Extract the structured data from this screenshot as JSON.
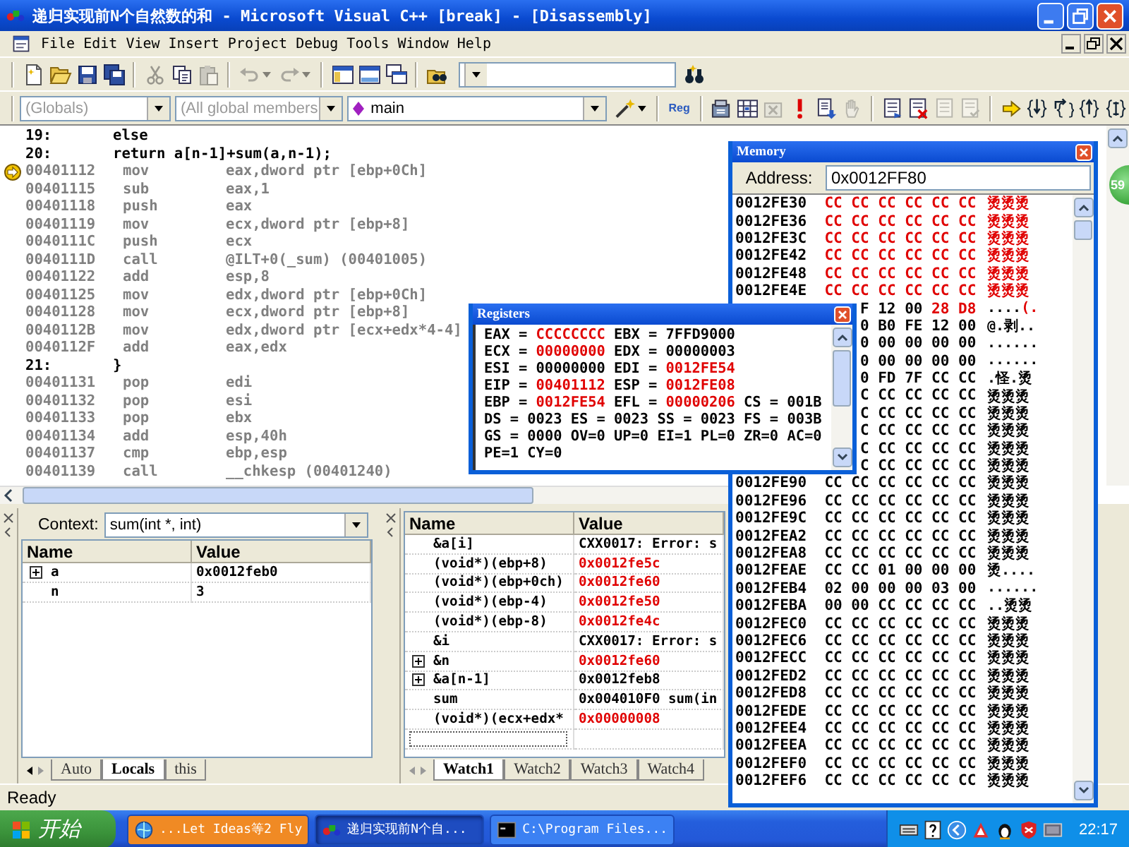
{
  "window": {
    "title": "递归实现前N个自然数的和 - Microsoft Visual C++ [break] - [Disassembly]"
  },
  "menu": [
    "File",
    "Edit",
    "View",
    "Insert",
    "Project",
    "Debug",
    "Tools",
    "Window",
    "Help"
  ],
  "toolbar_1": {
    "groups": [
      [
        {
          "kind": "new",
          "disabled": false
        },
        {
          "kind": "open",
          "disabled": false
        },
        {
          "kind": "save",
          "disabled": false
        },
        {
          "kind": "save_all",
          "disabled": false
        }
      ],
      [
        {
          "kind": "cut",
          "disabled": true
        },
        {
          "kind": "copy",
          "disabled": false
        },
        {
          "kind": "paste",
          "disabled": true
        }
      ],
      [
        {
          "kind": "undo",
          "disabled": true
        },
        {
          "kind": "redo",
          "disabled": true
        }
      ],
      [
        {
          "kind": "workspace",
          "disabled": false
        },
        {
          "kind": "output",
          "disabled": false
        },
        {
          "kind": "windows",
          "disabled": false
        }
      ],
      [
        {
          "kind": "find_in_files",
          "disabled": false
        }
      ]
    ],
    "after_field": [
      {
        "kind": "find",
        "disabled": false
      }
    ]
  },
  "toolbar_2": {
    "scope": {
      "value": "(Globals)",
      "disabled": true
    },
    "members": {
      "value": "(All global members",
      "disabled": true
    },
    "function": {
      "value": "main",
      "disabled": false
    },
    "groups": [
      [
        {
          "kind": "wizard",
          "disabled": false
        }
      ],
      [
        {
          "kind": "reg",
          "label": "Reg",
          "disabled": false
        }
      ],
      [
        {
          "kind": "compile",
          "disabled": false
        },
        {
          "kind": "build",
          "disabled": false
        },
        {
          "kind": "stop_build",
          "disabled": true
        },
        {
          "kind": "execute",
          "disabled": false
        },
        {
          "kind": "go",
          "disabled": false
        },
        {
          "kind": "breakpoint",
          "disabled": true
        }
      ],
      [
        {
          "kind": "list_arrow",
          "disabled": false
        },
        {
          "kind": "list_cross",
          "disabled": false
        },
        {
          "kind": "list_plain",
          "disabled": true
        },
        {
          "kind": "list_check",
          "disabled": true
        }
      ],
      [
        {
          "kind": "show_next",
          "disabled": false
        },
        {
          "kind": "step_into",
          "disabled": false
        },
        {
          "kind": "step_over",
          "disabled": false
        },
        {
          "kind": "step_out",
          "disabled": false
        },
        {
          "kind": "run_to_cursor",
          "disabled": false
        }
      ]
    ]
  },
  "disassembly": [
    {
      "kind": "source",
      "line": "19:",
      "code": "else"
    },
    {
      "kind": "source",
      "line": "20:",
      "code": "return a[n-1]+sum(a,n-1);"
    },
    {
      "kind": "asm",
      "address": "00401112",
      "op": "mov",
      "args": "eax,dword ptr [ebp+0Ch]",
      "current": true
    },
    {
      "kind": "asm",
      "address": "00401115",
      "op": "sub",
      "args": "eax,1",
      "current": false
    },
    {
      "kind": "asm",
      "address": "00401118",
      "op": "push",
      "args": "eax",
      "current": false
    },
    {
      "kind": "asm",
      "address": "00401119",
      "op": "mov",
      "args": "ecx,dword ptr [ebp+8]",
      "current": false
    },
    {
      "kind": "asm",
      "address": "0040111C",
      "op": "push",
      "args": "ecx",
      "current": false
    },
    {
      "kind": "asm",
      "address": "0040111D",
      "op": "call",
      "args": "@ILT+0(_sum) (00401005)",
      "current": false
    },
    {
      "kind": "asm",
      "address": "00401122",
      "op": "add",
      "args": "esp,8",
      "current": false
    },
    {
      "kind": "asm",
      "address": "00401125",
      "op": "mov",
      "args": "edx,dword ptr [ebp+0Ch]",
      "current": false
    },
    {
      "kind": "asm",
      "address": "00401128",
      "op": "mov",
      "args": "ecx,dword ptr [ebp+8]",
      "current": false
    },
    {
      "kind": "asm",
      "address": "0040112B",
      "op": "mov",
      "args": "edx,dword ptr [ecx+edx*4-4]",
      "current": false
    },
    {
      "kind": "asm",
      "address": "0040112F",
      "op": "add",
      "args": "eax,edx",
      "current": false
    },
    {
      "kind": "source",
      "line": "21:",
      "code": "}"
    },
    {
      "kind": "asm",
      "address": "00401131",
      "op": "pop",
      "args": "edi",
      "current": false
    },
    {
      "kind": "asm",
      "address": "00401132",
      "op": "pop",
      "args": "esi",
      "current": false
    },
    {
      "kind": "asm",
      "address": "00401133",
      "op": "pop",
      "args": "ebx",
      "current": false
    },
    {
      "kind": "asm",
      "address": "00401134",
      "op": "add",
      "args": "esp,40h",
      "current": false
    },
    {
      "kind": "asm",
      "address": "00401137",
      "op": "cmp",
      "args": "ebp,esp",
      "current": false
    },
    {
      "kind": "asm",
      "address": "00401139",
      "op": "call",
      "args": "__chkesp (00401240)",
      "current": false
    }
  ],
  "side_widget": {
    "text": "59"
  },
  "variables": {
    "context_label": "Context:",
    "context": "sum(int *, int)",
    "columns": [
      "Name",
      "Value"
    ],
    "rows": [
      {
        "name": "a",
        "value": "0x0012feb0",
        "expandable": true,
        "changed": false
      },
      {
        "name": "n",
        "value": "3",
        "expandable": false,
        "changed": false
      }
    ],
    "tabs": [
      {
        "label": "Auto",
        "selected": false
      },
      {
        "label": "Locals",
        "selected": true
      },
      {
        "label": "this",
        "selected": false
      }
    ]
  },
  "watch": {
    "columns": [
      "Name",
      "Value"
    ],
    "rows": [
      {
        "name": "&a[i]",
        "value": "CXX0017: Error: s",
        "expandable": false,
        "changed": false
      },
      {
        "name": "(void*)(ebp+8)",
        "value": "0x0012fe5c",
        "expandable": false,
        "changed": true
      },
      {
        "name": "(void*)(ebp+0ch)",
        "value": "0x0012fe60",
        "expandable": false,
        "changed": true
      },
      {
        "name": "(void*)(ebp-4)",
        "value": "0x0012fe50",
        "expandable": false,
        "changed": true
      },
      {
        "name": "(void*)(ebp-8)",
        "value": "0x0012fe4c",
        "expandable": false,
        "changed": true
      },
      {
        "name": "&i",
        "value": "CXX0017: Error: s",
        "expandable": false,
        "changed": false
      },
      {
        "name": "&n",
        "value": "0x0012fe60",
        "expandable": true,
        "changed": true
      },
      {
        "name": "&a[n-1]",
        "value": "0x0012feb8",
        "expandable": true,
        "changed": false
      },
      {
        "name": "sum",
        "value": "0x004010F0 sum(in",
        "expandable": false,
        "changed": false
      },
      {
        "name": "(void*)(ecx+edx*",
        "value": "0x00000008",
        "expandable": false,
        "changed": true
      }
    ],
    "tabs": [
      {
        "label": "Watch1",
        "selected": true
      },
      {
        "label": "Watch2",
        "selected": false
      },
      {
        "label": "Watch3",
        "selected": false
      },
      {
        "label": "Watch4",
        "selected": false
      }
    ]
  },
  "registers": {
    "title": "Registers",
    "lines": [
      [
        {
          "kind": "reg",
          "label": "EAX =",
          "value": "CCCCCCCC",
          "changed": true
        },
        {
          "kind": "reg",
          "label": "EBX =",
          "value": "7FFD9000",
          "changed": false
        }
      ],
      [
        {
          "kind": "reg",
          "label": "ECX =",
          "value": "00000000",
          "changed": true
        },
        {
          "kind": "reg",
          "label": "EDX =",
          "value": "00000003",
          "changed": false
        }
      ],
      [
        {
          "kind": "reg",
          "label": "ESI =",
          "value": "00000000",
          "changed": false
        },
        {
          "kind": "reg",
          "label": "EDI =",
          "value": "0012FE54",
          "changed": true
        }
      ],
      [
        {
          "kind": "reg",
          "label": "EIP =",
          "value": "00401112",
          "changed": true
        },
        {
          "kind": "reg",
          "label": "ESP =",
          "value": "0012FE08",
          "changed": true
        }
      ],
      [
        {
          "kind": "reg",
          "label": "EBP =",
          "value": "0012FE54",
          "changed": true
        },
        {
          "kind": "reg",
          "label": "EFL =",
          "value": "00000206",
          "changed": true
        },
        {
          "kind": "reg",
          "label": "CS =",
          "value": "001B",
          "changed": false
        }
      ],
      [
        {
          "kind": "reg",
          "label": "DS =",
          "value": "0023",
          "changed": false
        },
        {
          "kind": "reg",
          "label": "ES =",
          "value": "0023",
          "changed": false
        },
        {
          "kind": "reg",
          "label": "SS =",
          "value": "0023",
          "changed": false
        },
        {
          "kind": "reg",
          "label": "FS =",
          "value": "003B",
          "changed": false
        }
      ],
      [
        {
          "kind": "reg",
          "label": "GS =",
          "value": "0000",
          "changed": false
        },
        {
          "kind": "flag",
          "text": "OV=0"
        },
        {
          "kind": "flag",
          "text": "UP=0"
        },
        {
          "kind": "flag",
          "text": "EI=1"
        },
        {
          "kind": "flag",
          "text": "PL=0"
        },
        {
          "kind": "flag",
          "text": "ZR=0"
        },
        {
          "kind": "flag",
          "text": "AC=0"
        }
      ],
      [
        {
          "kind": "flag",
          "text": "PE=1"
        },
        {
          "kind": "flag",
          "text": "CY=0"
        }
      ]
    ]
  },
  "memory": {
    "title": "Memory",
    "address_label": "Address:",
    "address": "0x0012FF80",
    "rows": [
      {
        "address": "0012FE30",
        "bytes": [
          {
            "text": "CC CC CC CC CC CC",
            "changed": true
          }
        ],
        "ascii": [
          {
            "text": "烫烫烫",
            "changed": true
          }
        ]
      },
      {
        "address": "0012FE36",
        "bytes": [
          {
            "text": "CC CC CC CC CC CC",
            "changed": true
          }
        ],
        "ascii": [
          {
            "text": "烫烫烫",
            "changed": true
          }
        ]
      },
      {
        "address": "0012FE3C",
        "bytes": [
          {
            "text": "CC CC CC CC CC CC",
            "changed": true
          }
        ],
        "ascii": [
          {
            "text": "烫烫烫",
            "changed": true
          }
        ]
      },
      {
        "address": "0012FE42",
        "bytes": [
          {
            "text": "CC CC CC CC CC CC",
            "changed": true
          }
        ],
        "ascii": [
          {
            "text": "烫烫烫",
            "changed": true
          }
        ]
      },
      {
        "address": "0012FE48",
        "bytes": [
          {
            "text": "CC CC CC CC CC CC",
            "changed": true
          }
        ],
        "ascii": [
          {
            "text": "烫烫烫",
            "changed": true
          }
        ]
      },
      {
        "address": "0012FE4E",
        "bytes": [
          {
            "text": "CC CC CC CC CC CC",
            "changed": true
          }
        ],
        "ascii": [
          {
            "text": "烫烫烫",
            "changed": true
          }
        ]
      },
      {
        "bytes": [
          {
            "text": "F 12 00",
            "changed": false
          },
          {
            "text": "28 D8",
            "changed": true
          }
        ],
        "ascii": [
          {
            "text": "....",
            "changed": false
          },
          {
            "text": "(.",
            "changed": true
          }
        ]
      },
      {
        "bytes": [
          {
            "text": "0 B0 FE 12 00",
            "changed": false
          }
        ],
        "ascii": [
          {
            "text": "@.剥..",
            "changed": false
          }
        ]
      },
      {
        "bytes": [
          {
            "text": "0 00 00 00 00",
            "changed": false
          }
        ],
        "ascii": [
          {
            "text": "......",
            "changed": false
          }
        ]
      },
      {
        "bytes": [
          {
            "text": "0 00 00 00 00",
            "changed": false
          }
        ],
        "ascii": [
          {
            "text": "......",
            "changed": false
          }
        ]
      },
      {
        "bytes": [
          {
            "text": "0 FD 7F CC CC",
            "changed": false
          }
        ],
        "ascii": [
          {
            "text": ".怪.烫",
            "changed": false
          }
        ]
      },
      {
        "bytes": [
          {
            "text": "C CC CC CC CC",
            "changed": false
          }
        ],
        "ascii": [
          {
            "text": "烫烫烫",
            "changed": false
          }
        ]
      },
      {
        "bytes": [
          {
            "text": "C CC CC CC CC",
            "changed": false
          }
        ],
        "ascii": [
          {
            "text": "烫烫烫",
            "changed": false
          }
        ]
      },
      {
        "bytes": [
          {
            "text": "C CC CC CC CC",
            "changed": false
          }
        ],
        "ascii": [
          {
            "text": "烫烫烫",
            "changed": false
          }
        ]
      },
      {
        "bytes": [
          {
            "text": "C CC CC CC CC",
            "changed": false
          }
        ],
        "ascii": [
          {
            "text": "烫烫烫",
            "changed": false
          }
        ]
      },
      {
        "bytes": [
          {
            "text": "C CC CC CC CC",
            "changed": false
          }
        ],
        "ascii": [
          {
            "text": "烫烫烫",
            "changed": false
          }
        ]
      },
      {
        "address": "0012FE90",
        "bytes": [
          {
            "text": "CC CC CC CC CC CC",
            "changed": false
          }
        ],
        "ascii": [
          {
            "text": "烫烫烫",
            "changed": false
          }
        ]
      },
      {
        "address": "0012FE96",
        "bytes": [
          {
            "text": "CC CC CC CC CC CC",
            "changed": false
          }
        ],
        "ascii": [
          {
            "text": "烫烫烫",
            "changed": false
          }
        ]
      },
      {
        "address": "0012FE9C",
        "bytes": [
          {
            "text": "CC CC CC CC CC CC",
            "changed": false
          }
        ],
        "ascii": [
          {
            "text": "烫烫烫",
            "changed": false
          }
        ]
      },
      {
        "address": "0012FEA2",
        "bytes": [
          {
            "text": "CC CC CC CC CC CC",
            "changed": false
          }
        ],
        "ascii": [
          {
            "text": "烫烫烫",
            "changed": false
          }
        ]
      },
      {
        "address": "0012FEA8",
        "bytes": [
          {
            "text": "CC CC CC CC CC CC",
            "changed": false
          }
        ],
        "ascii": [
          {
            "text": "烫烫烫",
            "changed": false
          }
        ]
      },
      {
        "address": "0012FEAE",
        "bytes": [
          {
            "text": "CC CC 01 00 00 00",
            "changed": false
          }
        ],
        "ascii": [
          {
            "text": "烫....",
            "changed": false
          }
        ]
      },
      {
        "address": "0012FEB4",
        "bytes": [
          {
            "text": "02 00 00 00 03 00",
            "changed": false
          }
        ],
        "ascii": [
          {
            "text": "......",
            "changed": false
          }
        ]
      },
      {
        "address": "0012FEBA",
        "bytes": [
          {
            "text": "00 00 CC CC CC CC",
            "changed": false
          }
        ],
        "ascii": [
          {
            "text": "..烫烫",
            "changed": false
          }
        ]
      },
      {
        "address": "0012FEC0",
        "bytes": [
          {
            "text": "CC CC CC CC CC CC",
            "changed": false
          }
        ],
        "ascii": [
          {
            "text": "烫烫烫",
            "changed": false
          }
        ]
      },
      {
        "address": "0012FEC6",
        "bytes": [
          {
            "text": "CC CC CC CC CC CC",
            "changed": false
          }
        ],
        "ascii": [
          {
            "text": "烫烫烫",
            "changed": false
          }
        ]
      },
      {
        "address": "0012FECC",
        "bytes": [
          {
            "text": "CC CC CC CC CC CC",
            "changed": false
          }
        ],
        "ascii": [
          {
            "text": "烫烫烫",
            "changed": false
          }
        ]
      },
      {
        "address": "0012FED2",
        "bytes": [
          {
            "text": "CC CC CC CC CC CC",
            "changed": false
          }
        ],
        "ascii": [
          {
            "text": "烫烫烫",
            "changed": false
          }
        ]
      },
      {
        "address": "0012FED8",
        "bytes": [
          {
            "text": "CC CC CC CC CC CC",
            "changed": false
          }
        ],
        "ascii": [
          {
            "text": "烫烫烫",
            "changed": false
          }
        ]
      },
      {
        "address": "0012FEDE",
        "bytes": [
          {
            "text": "CC CC CC CC CC CC",
            "changed": false
          }
        ],
        "ascii": [
          {
            "text": "烫烫烫",
            "changed": false
          }
        ]
      },
      {
        "address": "0012FEE4",
        "bytes": [
          {
            "text": "CC CC CC CC CC CC",
            "changed": false
          }
        ],
        "ascii": [
          {
            "text": "烫烫烫",
            "changed": false
          }
        ]
      },
      {
        "address": "0012FEEA",
        "bytes": [
          {
            "text": "CC CC CC CC CC CC",
            "changed": false
          }
        ],
        "ascii": [
          {
            "text": "烫烫烫",
            "changed": false
          }
        ]
      },
      {
        "address": "0012FEF0",
        "bytes": [
          {
            "text": "CC CC CC CC CC CC",
            "changed": false
          }
        ],
        "ascii": [
          {
            "text": "烫烫烫",
            "changed": false
          }
        ]
      },
      {
        "address": "0012FEF6",
        "bytes": [
          {
            "text": "CC CC CC CC CC CC",
            "changed": false
          }
        ],
        "ascii": [
          {
            "text": "烫烫烫",
            "changed": false
          }
        ]
      }
    ]
  },
  "status_bar": {
    "text": "Ready"
  },
  "taskbar": {
    "start": "开始",
    "tasks": [
      {
        "kind": "browser",
        "label": "...Let Ideas等2 Fly",
        "selected": false,
        "flashing": true
      },
      {
        "kind": "ide",
        "label": "递归实现前N个自...",
        "selected": true,
        "flashing": false
      },
      {
        "kind": "console",
        "label": "C:\\Program Files...",
        "selected": false,
        "flashing": false
      }
    ],
    "clock": "22:17"
  }
}
